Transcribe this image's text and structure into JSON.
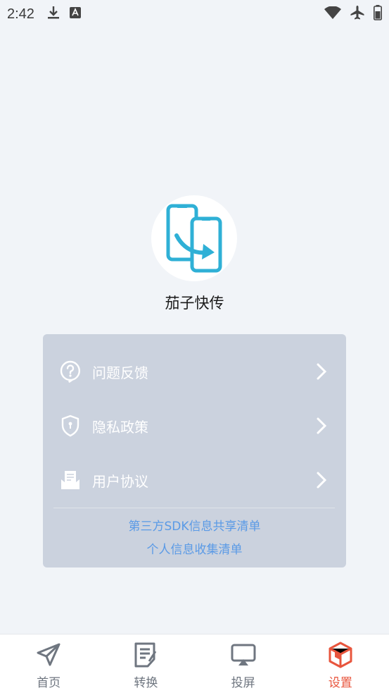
{
  "status_bar": {
    "time": "2:42"
  },
  "app": {
    "name": "茄子快传"
  },
  "menu": {
    "items": [
      {
        "label": "问题反馈",
        "icon": "question-bubble-icon"
      },
      {
        "label": "隐私政策",
        "icon": "shield-icon"
      },
      {
        "label": "用户协议",
        "icon": "document-icon"
      }
    ],
    "links": [
      "第三方SDK信息共享清单",
      "个人信息收集清单"
    ]
  },
  "tabbar": {
    "tabs": [
      {
        "label": "首页",
        "icon": "send-arrow-icon",
        "active": false
      },
      {
        "label": "转换",
        "icon": "notes-icon",
        "active": false
      },
      {
        "label": "投屏",
        "icon": "screen-cast-icon",
        "active": false
      },
      {
        "label": "设置",
        "icon": "settings-box-icon",
        "active": true
      }
    ]
  },
  "colors": {
    "background": "#f1f4f8",
    "card": "#cbd2de",
    "link": "#5a9ae6",
    "accent": "#e8553d",
    "logo_blue": "#2fb0d6"
  }
}
